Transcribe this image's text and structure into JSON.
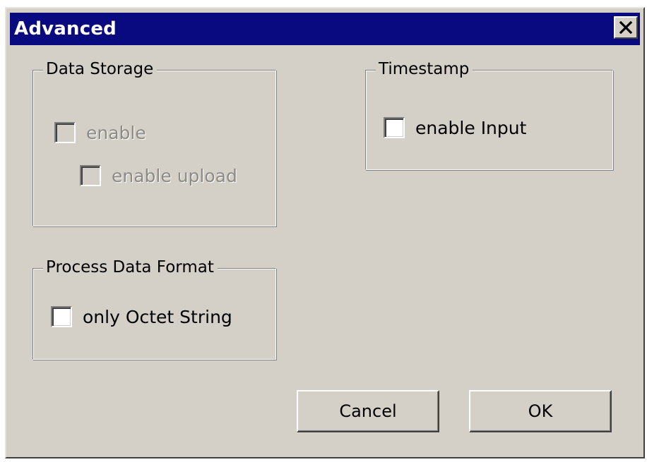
{
  "window": {
    "title": "Advanced"
  },
  "titlebar": {
    "close_icon": "close-x-icon",
    "colors": {
      "background": "#0a0a80",
      "text": "#ffffff"
    }
  },
  "data_storage": {
    "legend": "Data Storage",
    "enable": {
      "label": "enable",
      "checked": false,
      "disabled": true
    },
    "enable_upload": {
      "label": "enable upload",
      "checked": false,
      "disabled": true
    }
  },
  "timestamp": {
    "legend": "Timestamp",
    "enable_input": {
      "label": "enable Input",
      "checked": false,
      "disabled": false
    }
  },
  "process_data_format": {
    "legend": "Process Data Format",
    "only_octet_string": {
      "label": "only Octet String",
      "checked": false,
      "disabled": false
    }
  },
  "buttons": {
    "cancel": "Cancel",
    "ok": "OK"
  },
  "colors": {
    "face": "#d4d0c8",
    "disabled_text": "#8c8a85"
  }
}
